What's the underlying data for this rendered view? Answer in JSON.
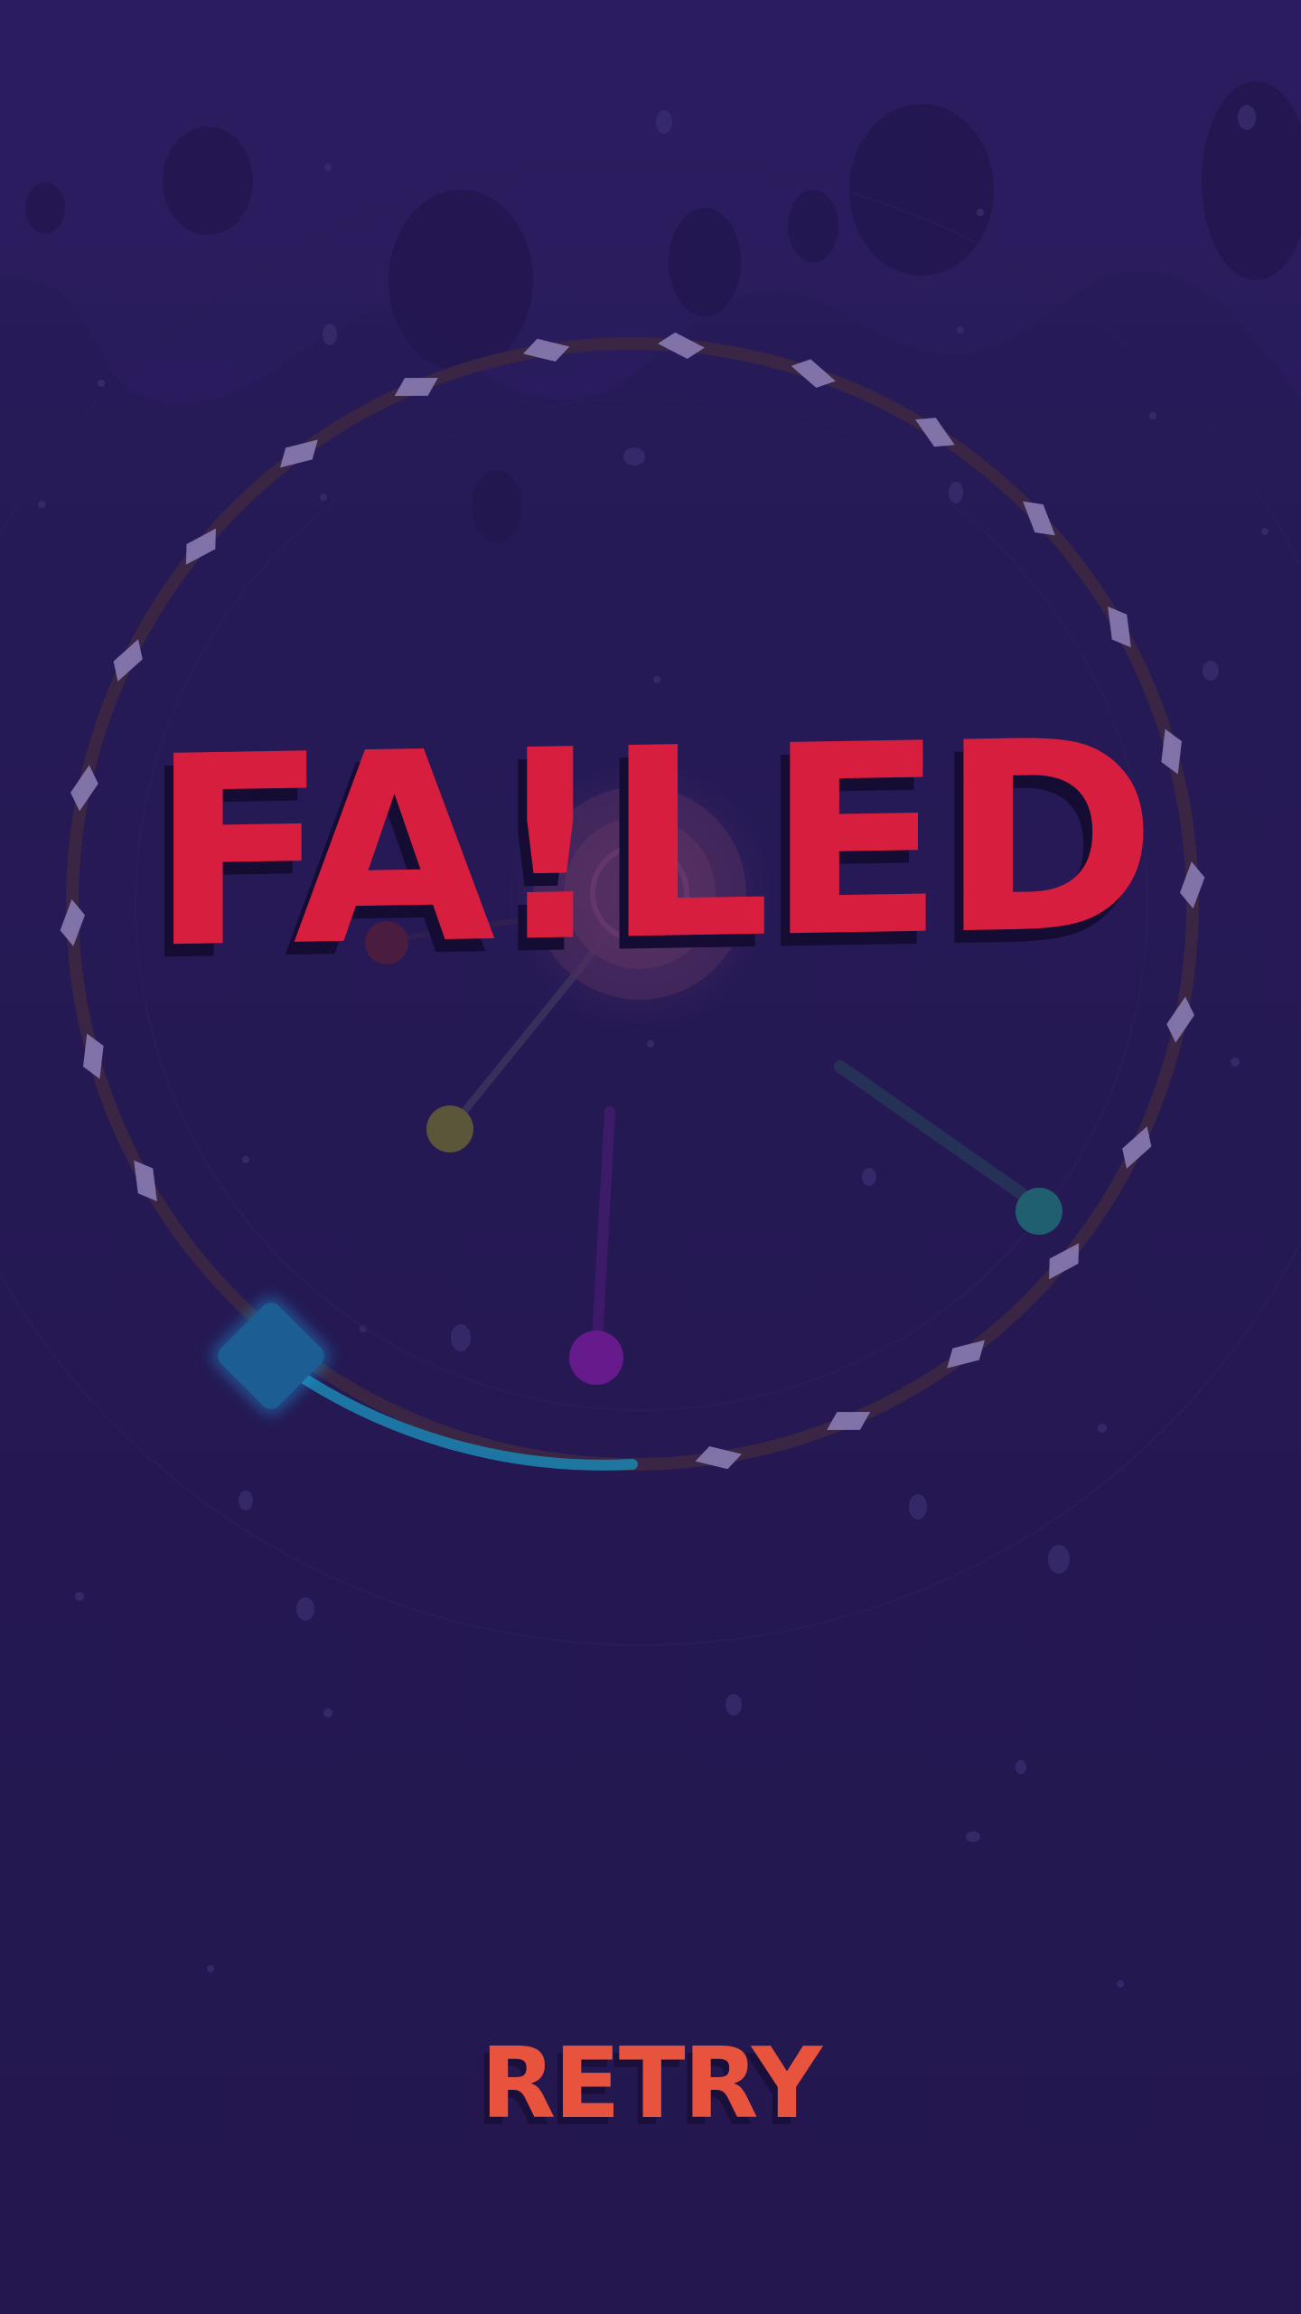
{
  "screen": {
    "failed_text": "FA!LED",
    "retry_label": "RETRY"
  },
  "colors": {
    "background": "#241752",
    "background_top": "#2b1d62",
    "blob": "#24184f",
    "track": "#3a2544",
    "track_gem": "#8a7bb3",
    "failed_text": "#d81e3f",
    "text_shadow": "#140c33",
    "retry_text": "#e8533d",
    "player": "#1c5e93",
    "player_trail": "#1b86b0",
    "orb_yellow": "#5b5539",
    "orb_teal": "#1f5f70",
    "orb_purple": "#671a8c",
    "orb_red": "#4a1c40",
    "center_target": "#4e2e5e"
  },
  "icons": {
    "player": "diamond-player-icon",
    "orbs": "orb-icon",
    "gems": "gem-icon"
  }
}
